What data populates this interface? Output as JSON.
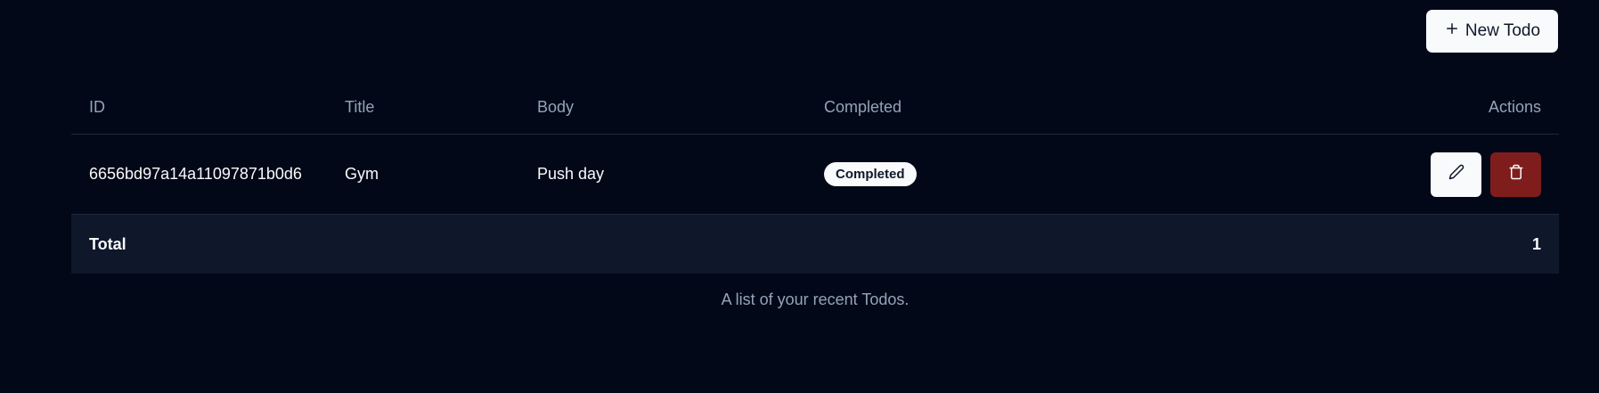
{
  "toolbar": {
    "new_label": "New Todo"
  },
  "table": {
    "headers": {
      "id": "ID",
      "title": "Title",
      "body": "Body",
      "completed": "Completed",
      "actions": "Actions"
    },
    "rows": [
      {
        "id": "6656bd97a14a11097871b0d6",
        "title": "Gym",
        "body": "Push day",
        "completed": "Completed"
      }
    ],
    "footer": {
      "label": "Total",
      "value": "1"
    },
    "caption": "A list of your recent Todos."
  },
  "icons": {
    "new": "plus-icon",
    "edit": "pencil-icon",
    "delete": "trash-icon"
  },
  "colors": {
    "background": "#020817",
    "primary_button": "#f8fafc",
    "destructive": "#7f1d1d",
    "muted_text": "#94a3b8"
  }
}
